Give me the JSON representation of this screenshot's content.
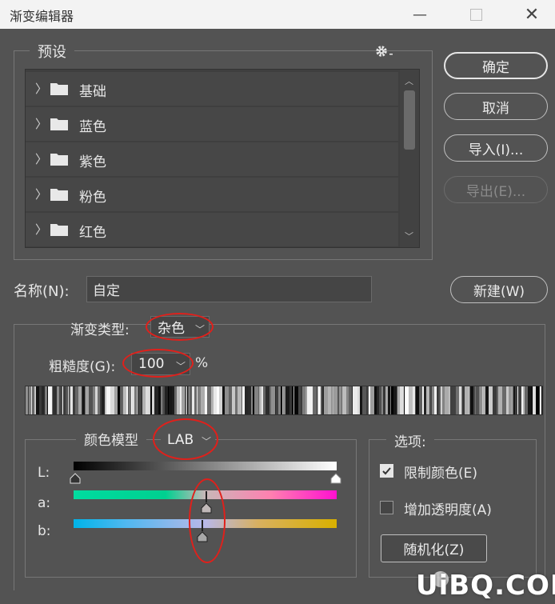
{
  "window": {
    "title": "渐变编辑器"
  },
  "presets": {
    "legend": "预设",
    "items": [
      {
        "label": "基础"
      },
      {
        "label": "蓝色"
      },
      {
        "label": "紫色"
      },
      {
        "label": "粉色"
      },
      {
        "label": "红色"
      }
    ]
  },
  "buttons": {
    "ok": "确定",
    "cancel": "取消",
    "import": "导入(I)...",
    "export": "导出(E)...",
    "new": "新建(W)",
    "randomize": "随机化(Z)"
  },
  "name_field": {
    "label": "名称(N):",
    "value": "自定"
  },
  "gradient_type": {
    "label": "渐变类型:",
    "value": "杂色"
  },
  "roughness": {
    "label": "粗糙度(G):",
    "value": "100",
    "unit": "%"
  },
  "color_model": {
    "label": "颜色模型",
    "value": "LAB",
    "channels": [
      {
        "label": "L:",
        "stops": [
          0,
          1
        ]
      },
      {
        "label": "a:",
        "stops": [
          0.5
        ]
      },
      {
        "label": "b:",
        "stops": [
          0.5
        ]
      }
    ]
  },
  "options": {
    "legend": "选项:",
    "restrict_colors": {
      "label": "限制颜色(E)",
      "checked": true
    },
    "add_transparency": {
      "label": "增加透明度(A)",
      "checked": false
    }
  },
  "colors": {
    "background": "#535353",
    "annotation": "#e0201b"
  },
  "watermark": "UiBQ.COM"
}
